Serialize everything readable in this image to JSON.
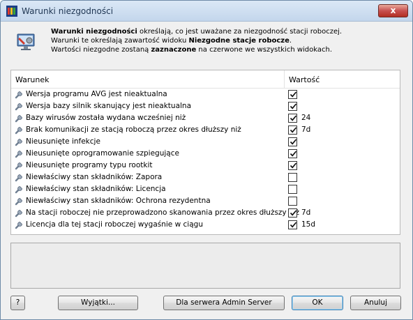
{
  "window": {
    "title": "Warunki niezgodności",
    "close_glyph": "x"
  },
  "header": {
    "line1_bold": "Warunki niezgodności",
    "line1_rest": " określają, co jest uważane za niezgodność stacji roboczej.",
    "line2_start": "Warunki te określają zawartość widoku ",
    "line2_bold": "Niezgodne stacje robocze",
    "line2_end": ".",
    "line3_start": "Wartości niezgodne zostaną ",
    "line3_bold": "zaznaczone",
    "line3_end": " na czerwone we wszystkich widokach."
  },
  "table": {
    "col_condition": "Warunek",
    "col_value": "Wartość",
    "rows": [
      {
        "label": "Wersja programu AVG jest nieaktualna",
        "checked": true,
        "value": ""
      },
      {
        "label": "Wersja bazy silnik skanujący jest nieaktualna",
        "checked": true,
        "value": ""
      },
      {
        "label": "Bazy wirusów została wydana wcześniej niż",
        "checked": true,
        "value": "24"
      },
      {
        "label": "Brak komunikacji ze stacją roboczą przez okres dłuższy niż",
        "checked": true,
        "value": "7d"
      },
      {
        "label": "Nieusunięte infekcje",
        "checked": true,
        "value": ""
      },
      {
        "label": "Nieusunięte oprogramowanie szpiegujące",
        "checked": true,
        "value": ""
      },
      {
        "label": "Nieusunięte programy typu rootkit",
        "checked": true,
        "value": ""
      },
      {
        "label": "Niewłaściwy stan składników: Zapora",
        "checked": false,
        "value": ""
      },
      {
        "label": "Niewłaściwy stan składników: Licencja",
        "checked": false,
        "value": ""
      },
      {
        "label": "Niewłaściwy stan składników: Ochrona rezydentna",
        "checked": false,
        "value": ""
      },
      {
        "label": "Na stacji roboczej nie przeprowadzono skanowania przez okres dłuższy niż",
        "checked": true,
        "value": "7d"
      },
      {
        "label": "Licencja dla tej stacji roboczej wygaśnie w ciągu",
        "checked": true,
        "value": "15d"
      }
    ]
  },
  "buttons": {
    "help": "?",
    "exceptions": "Wyjątki...",
    "admin_server": "Dla serwera Admin Server",
    "ok": "OK",
    "cancel": "Anuluj"
  },
  "icons": {
    "app": "avg-logo-icon",
    "header": "monitor-wrench-icon",
    "row": "wrench-icon",
    "check": "checkmark-icon"
  }
}
